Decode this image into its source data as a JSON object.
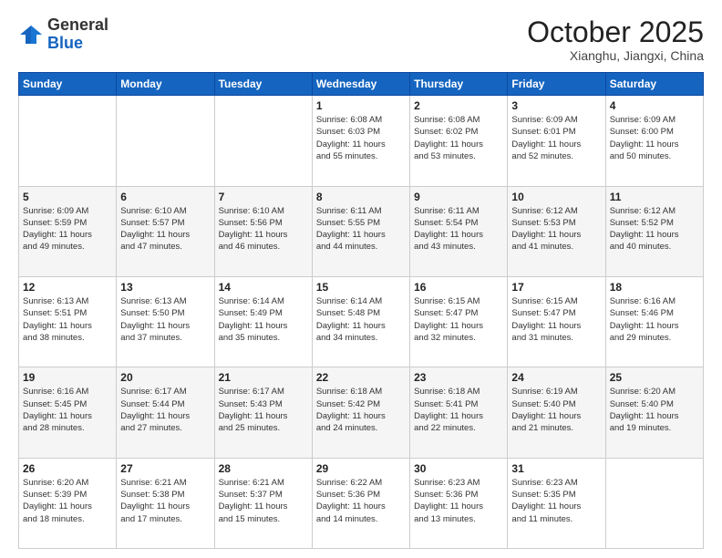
{
  "header": {
    "logo": {
      "line1": "General",
      "line2": "Blue"
    },
    "title": "October 2025",
    "location": "Xianghu, Jiangxi, China"
  },
  "days_of_week": [
    "Sunday",
    "Monday",
    "Tuesday",
    "Wednesday",
    "Thursday",
    "Friday",
    "Saturday"
  ],
  "weeks": [
    [
      {
        "day": "",
        "info": ""
      },
      {
        "day": "",
        "info": ""
      },
      {
        "day": "",
        "info": ""
      },
      {
        "day": "1",
        "info": "Sunrise: 6:08 AM\nSunset: 6:03 PM\nDaylight: 11 hours\nand 55 minutes."
      },
      {
        "day": "2",
        "info": "Sunrise: 6:08 AM\nSunset: 6:02 PM\nDaylight: 11 hours\nand 53 minutes."
      },
      {
        "day": "3",
        "info": "Sunrise: 6:09 AM\nSunset: 6:01 PM\nDaylight: 11 hours\nand 52 minutes."
      },
      {
        "day": "4",
        "info": "Sunrise: 6:09 AM\nSunset: 6:00 PM\nDaylight: 11 hours\nand 50 minutes."
      }
    ],
    [
      {
        "day": "5",
        "info": "Sunrise: 6:09 AM\nSunset: 5:59 PM\nDaylight: 11 hours\nand 49 minutes."
      },
      {
        "day": "6",
        "info": "Sunrise: 6:10 AM\nSunset: 5:57 PM\nDaylight: 11 hours\nand 47 minutes."
      },
      {
        "day": "7",
        "info": "Sunrise: 6:10 AM\nSunset: 5:56 PM\nDaylight: 11 hours\nand 46 minutes."
      },
      {
        "day": "8",
        "info": "Sunrise: 6:11 AM\nSunset: 5:55 PM\nDaylight: 11 hours\nand 44 minutes."
      },
      {
        "day": "9",
        "info": "Sunrise: 6:11 AM\nSunset: 5:54 PM\nDaylight: 11 hours\nand 43 minutes."
      },
      {
        "day": "10",
        "info": "Sunrise: 6:12 AM\nSunset: 5:53 PM\nDaylight: 11 hours\nand 41 minutes."
      },
      {
        "day": "11",
        "info": "Sunrise: 6:12 AM\nSunset: 5:52 PM\nDaylight: 11 hours\nand 40 minutes."
      }
    ],
    [
      {
        "day": "12",
        "info": "Sunrise: 6:13 AM\nSunset: 5:51 PM\nDaylight: 11 hours\nand 38 minutes."
      },
      {
        "day": "13",
        "info": "Sunrise: 6:13 AM\nSunset: 5:50 PM\nDaylight: 11 hours\nand 37 minutes."
      },
      {
        "day": "14",
        "info": "Sunrise: 6:14 AM\nSunset: 5:49 PM\nDaylight: 11 hours\nand 35 minutes."
      },
      {
        "day": "15",
        "info": "Sunrise: 6:14 AM\nSunset: 5:48 PM\nDaylight: 11 hours\nand 34 minutes."
      },
      {
        "day": "16",
        "info": "Sunrise: 6:15 AM\nSunset: 5:47 PM\nDaylight: 11 hours\nand 32 minutes."
      },
      {
        "day": "17",
        "info": "Sunrise: 6:15 AM\nSunset: 5:47 PM\nDaylight: 11 hours\nand 31 minutes."
      },
      {
        "day": "18",
        "info": "Sunrise: 6:16 AM\nSunset: 5:46 PM\nDaylight: 11 hours\nand 29 minutes."
      }
    ],
    [
      {
        "day": "19",
        "info": "Sunrise: 6:16 AM\nSunset: 5:45 PM\nDaylight: 11 hours\nand 28 minutes."
      },
      {
        "day": "20",
        "info": "Sunrise: 6:17 AM\nSunset: 5:44 PM\nDaylight: 11 hours\nand 27 minutes."
      },
      {
        "day": "21",
        "info": "Sunrise: 6:17 AM\nSunset: 5:43 PM\nDaylight: 11 hours\nand 25 minutes."
      },
      {
        "day": "22",
        "info": "Sunrise: 6:18 AM\nSunset: 5:42 PM\nDaylight: 11 hours\nand 24 minutes."
      },
      {
        "day": "23",
        "info": "Sunrise: 6:18 AM\nSunset: 5:41 PM\nDaylight: 11 hours\nand 22 minutes."
      },
      {
        "day": "24",
        "info": "Sunrise: 6:19 AM\nSunset: 5:40 PM\nDaylight: 11 hours\nand 21 minutes."
      },
      {
        "day": "25",
        "info": "Sunrise: 6:20 AM\nSunset: 5:40 PM\nDaylight: 11 hours\nand 19 minutes."
      }
    ],
    [
      {
        "day": "26",
        "info": "Sunrise: 6:20 AM\nSunset: 5:39 PM\nDaylight: 11 hours\nand 18 minutes."
      },
      {
        "day": "27",
        "info": "Sunrise: 6:21 AM\nSunset: 5:38 PM\nDaylight: 11 hours\nand 17 minutes."
      },
      {
        "day": "28",
        "info": "Sunrise: 6:21 AM\nSunset: 5:37 PM\nDaylight: 11 hours\nand 15 minutes."
      },
      {
        "day": "29",
        "info": "Sunrise: 6:22 AM\nSunset: 5:36 PM\nDaylight: 11 hours\nand 14 minutes."
      },
      {
        "day": "30",
        "info": "Sunrise: 6:23 AM\nSunset: 5:36 PM\nDaylight: 11 hours\nand 13 minutes."
      },
      {
        "day": "31",
        "info": "Sunrise: 6:23 AM\nSunset: 5:35 PM\nDaylight: 11 hours\nand 11 minutes."
      },
      {
        "day": "",
        "info": ""
      }
    ]
  ]
}
